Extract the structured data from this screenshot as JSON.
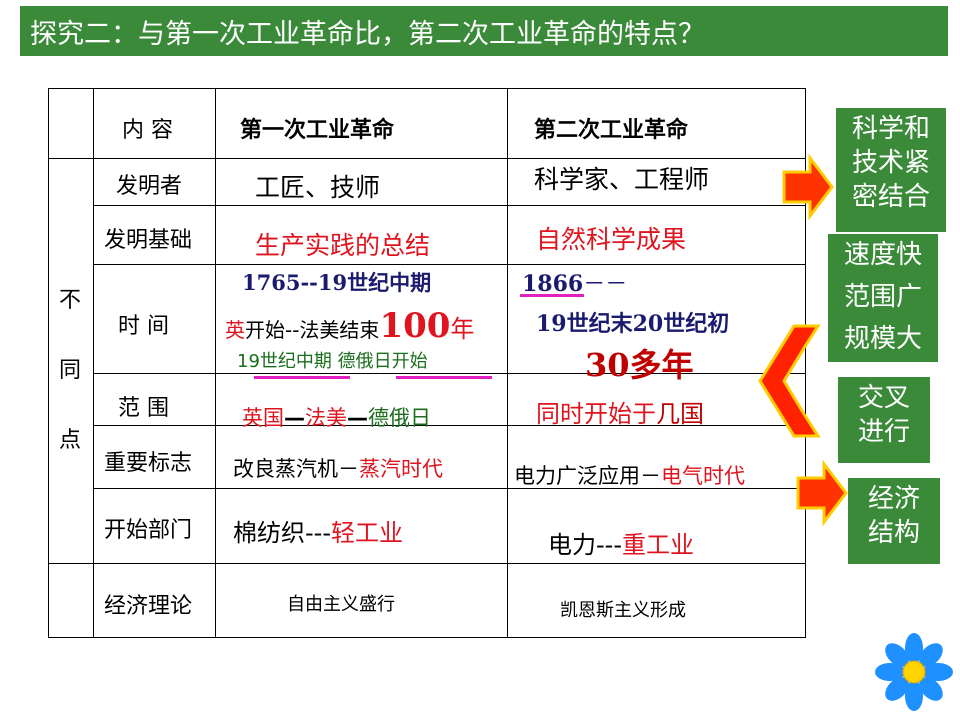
{
  "title": "探究二：与第一次工业革命比，第二次工业革命的特点？",
  "table": {
    "side_label": [
      "不",
      "同",
      "点"
    ],
    "header": {
      "col0": "内  容",
      "col1": "第一次工业革命",
      "col2": "第二次工业革命"
    },
    "rows": [
      {
        "label": "发明者",
        "first": "工匠、技师",
        "second": "科学家、工程师"
      },
      {
        "label": "发明基础",
        "first": "生产实践的总结",
        "second": "自然科学成果"
      },
      {
        "label": "时  间",
        "first": {
          "line1": "1765--19世纪中期",
          "line2a": "英",
          "line2b": "开始--法美结束",
          "line2c": "100",
          "line2d": "年",
          "line3a": "19世纪中期 ",
          "line3b": "德俄日",
          "line3c": "开始"
        },
        "second": {
          "line1a": "1866",
          "line1b": "－－",
          "line2": "19世纪末20世纪初",
          "line3": "30多年"
        }
      },
      {
        "label": "范  围",
        "first": {
          "a": "英国",
          "b": "—",
          "c": "法美",
          "d": "—",
          "e": "德俄日"
        },
        "second": {
          "a": "同时开始于",
          "b": "几国"
        }
      },
      {
        "label": "重要标志",
        "first": {
          "a": "改良蒸汽机－",
          "b": "蒸汽时代"
        },
        "second": {
          "a": "电力广泛应用－",
          "b": "电气时代"
        }
      },
      {
        "label": "开始部门",
        "first": {
          "a": "棉纺织---",
          "b": "轻工业"
        },
        "second": {
          "a": "电力---",
          "b": "重工业"
        }
      },
      {
        "label": "经济理论",
        "first": "自由主义盛行",
        "second": "凯恩斯主义形成"
      }
    ]
  },
  "side_boxes": [
    {
      "lines": [
        "科学和",
        "技术紧",
        "密结合"
      ]
    },
    {
      "lines": [
        "速度快",
        "范围广",
        "规模大"
      ]
    },
    {
      "lines": [
        "交叉",
        "进行"
      ]
    },
    {
      "lines": [
        "经济",
        "结构"
      ]
    }
  ],
  "colors": {
    "green": "#3a8a3a",
    "red": "#e0141e",
    "arrow_orange": "#ff3300",
    "arrow_yellow": "#ffcc00",
    "flower_blue": "#1e90ff",
    "underline_magenta": "#e020c0"
  },
  "decor": {
    "flower_icon": "flower-icon"
  }
}
